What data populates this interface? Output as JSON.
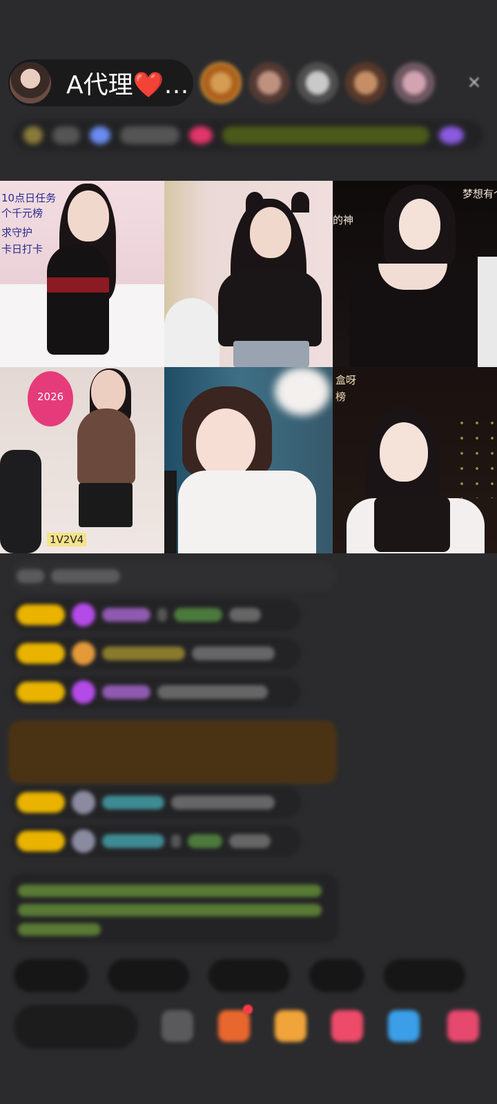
{
  "host": {
    "name": "A代理❤️…",
    "avatar_icon": "host-avatar"
  },
  "close_icon": "×",
  "video_grid": {
    "tiles": [
      {
        "label_top": "10点日任务",
        "label_mid": "个千元榜",
        "label_a": "求守护",
        "label_b": "卡日打卡"
      },
      {},
      {
        "label_corner": "梦想有个",
        "label_side": "的神"
      },
      {
        "heart_text": "2026",
        "badge": "1V2V4"
      },
      {},
      {
        "label_a": "盒呀",
        "label_b": "榜"
      }
    ]
  },
  "colors": {
    "background": "#2b2b2d",
    "level_badge": "#e9b300",
    "highlight_bg": "#4a3315",
    "gem_purple": "#a03ad6",
    "name_teal": "#4fb5c0"
  }
}
